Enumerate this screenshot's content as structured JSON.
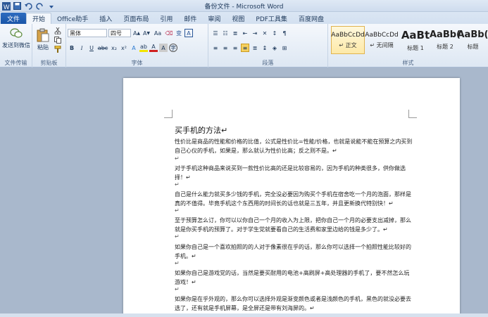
{
  "window": {
    "title": "备份文件 - Microsoft Word"
  },
  "tabs": [
    {
      "label": "文件"
    },
    {
      "label": "开始"
    },
    {
      "label": "Office助手"
    },
    {
      "label": "插入"
    },
    {
      "label": "页面布局"
    },
    {
      "label": "引用"
    },
    {
      "label": "邮件"
    },
    {
      "label": "审阅"
    },
    {
      "label": "视图"
    },
    {
      "label": "PDF工具集"
    },
    {
      "label": "百度网盘"
    }
  ],
  "ribbon": {
    "send_wechat": "发送到微信",
    "paste": "粘贴",
    "font_name": "黑体",
    "font_size": "四号",
    "groups": {
      "file_transfer": "文件传输",
      "clipboard": "剪贴板",
      "font": "字体",
      "paragraph": "段落",
      "styles": "样式"
    },
    "styles": [
      {
        "sample": "AaBbCcDd",
        "name": "↵ 正文"
      },
      {
        "sample": "AaBbCcDd",
        "name": "↵ 无间隔"
      },
      {
        "sample": "AaBt",
        "name": "标题 1"
      },
      {
        "sample": "AaBb(",
        "name": "标题 2"
      },
      {
        "sample": "AaBb(",
        "name": "标题"
      }
    ]
  },
  "document": {
    "title": "买手机的方法↵",
    "paragraphs": [
      "性价比是商品的性能和价格的比值，公式是性价比=性能/价格，也就是说能不能在预算之内买到自己心仪的手机，如果是，那么就认为性价比高；反之则不是。↵",
      "对于手机这种商品来说买到一款性价比高的还是比较容易的，因为手机的种类很多，供你做选择！↵",
      "自己是什么能力就买多少钱的手机，完全没必要因为购买个手机在宿舍吃一个月的泡面，那样是真的不值得。毕竟手机这个东西用的时间长的话也就是三五年，并且更新换代特别快！↵",
      "至于预算怎么订，你可以以你自己一个月的收入为上限，把你自己一个月的必要支出减掉，那么就是你买手机的预算了。对于学生党就要看自己的生活费和家里边给的钱是多少了。↵",
      "如果你自己是一个喜欢拍照的的人对于像素很在乎的话，那么你可以选择一个拍照性能比较好的手机。↵",
      "如果你自己是游戏党的话，当然是要买耐用的电池+高刷屏+高处理器的手机了，要不然怎么玩游戏！↵",
      "如果你是在乎外观的，那么你可以选择外观是渐变颜色或者是浅颜色的手机，黑色的就没必要去选了，还有就是手机屏幕，是全屏还是带有刘海屏的。↵"
    ],
    "empty_mark": "↵"
  }
}
